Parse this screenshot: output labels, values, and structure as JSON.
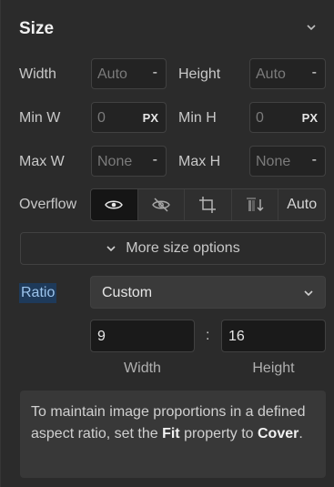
{
  "section": {
    "title": "Size"
  },
  "rows": {
    "width_label": "Width",
    "width_value": "Auto",
    "width_suffix": "-",
    "height_label": "Height",
    "height_value": "Auto",
    "height_suffix": "-",
    "minw_label": "Min W",
    "minw_value": "0",
    "minw_unit": "PX",
    "minh_label": "Min H",
    "minh_value": "0",
    "minh_unit": "PX",
    "maxw_label": "Max W",
    "maxw_value": "None",
    "maxw_suffix": "-",
    "maxh_label": "Max H",
    "maxh_value": "None",
    "maxh_suffix": "-"
  },
  "overflow": {
    "label": "Overflow",
    "options": [
      "visible",
      "hidden",
      "scroll",
      "auto"
    ],
    "auto_label": "Auto",
    "selected": "visible"
  },
  "more_options": {
    "label": "More size options"
  },
  "ratio": {
    "label": "Ratio",
    "selected": "Custom",
    "width_value": "9",
    "height_value": "16",
    "separator": ":",
    "width_caption": "Width",
    "height_caption": "Height"
  },
  "hint": {
    "text_before": "To maintain image proportions in a defined aspect ratio, set the ",
    "fit": "Fit",
    "text_mid": " property to ",
    "cover": "Cover",
    "text_after": "."
  },
  "colors": {
    "panel_bg": "#2b2b2b",
    "field_bg": "#232323",
    "accent_label_bg": "#1e3a5a"
  }
}
